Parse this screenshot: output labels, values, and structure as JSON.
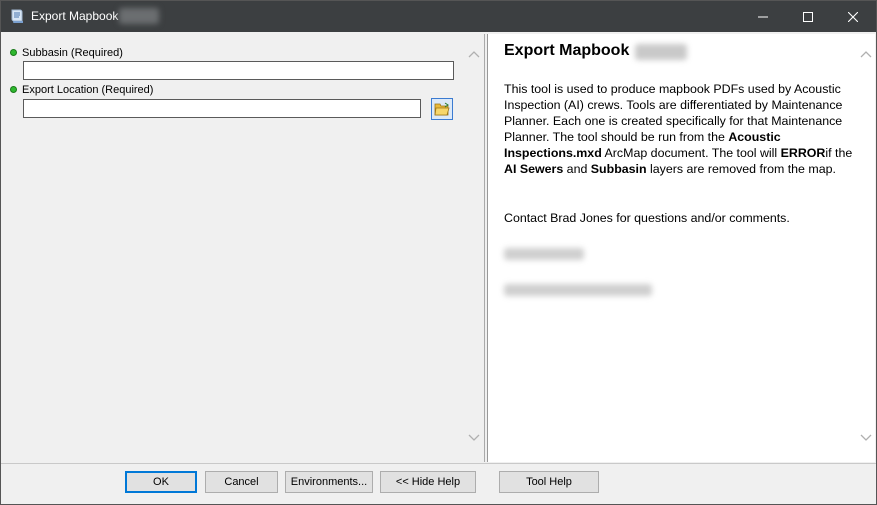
{
  "window": {
    "title": "Export Mapbook",
    "title_suffix_redacted": true
  },
  "params": [
    {
      "label": "Subbasin (Required)",
      "value": ""
    },
    {
      "label": "Export Location (Required)",
      "value": ""
    }
  ],
  "help": {
    "title": "Export Mapbook",
    "p1_a": "This tool is used to produce mapbook PDFs used by Acoustic Inspection (AI) crews. Tools are differentiated by Maintenance Planner. Each one is created specifically for that Maintenance Planner. The tool should be run from the ",
    "p1_b": "Acoustic Inspections.mxd",
    "p1_c": " ArcMap document. The tool will ",
    "p1_d": "ERROR",
    "p1_e": "if the ",
    "p1_f": "AI Sewers",
    "p1_g": " and ",
    "p1_h": "Subbasin",
    "p1_i": " layers are removed from the map.",
    "contact": "Contact Brad Jones for questions and/or comments."
  },
  "buttons": {
    "ok": "OK",
    "cancel": "Cancel",
    "environments": "Environments...",
    "hide_help": "<< Hide Help",
    "tool_help": "Tool Help"
  },
  "icons": {
    "app": "arcmap-scroll-icon",
    "browse": "folder-open-icon",
    "minimize": "minimize-icon",
    "maximize": "maximize-icon",
    "close": "close-icon"
  }
}
